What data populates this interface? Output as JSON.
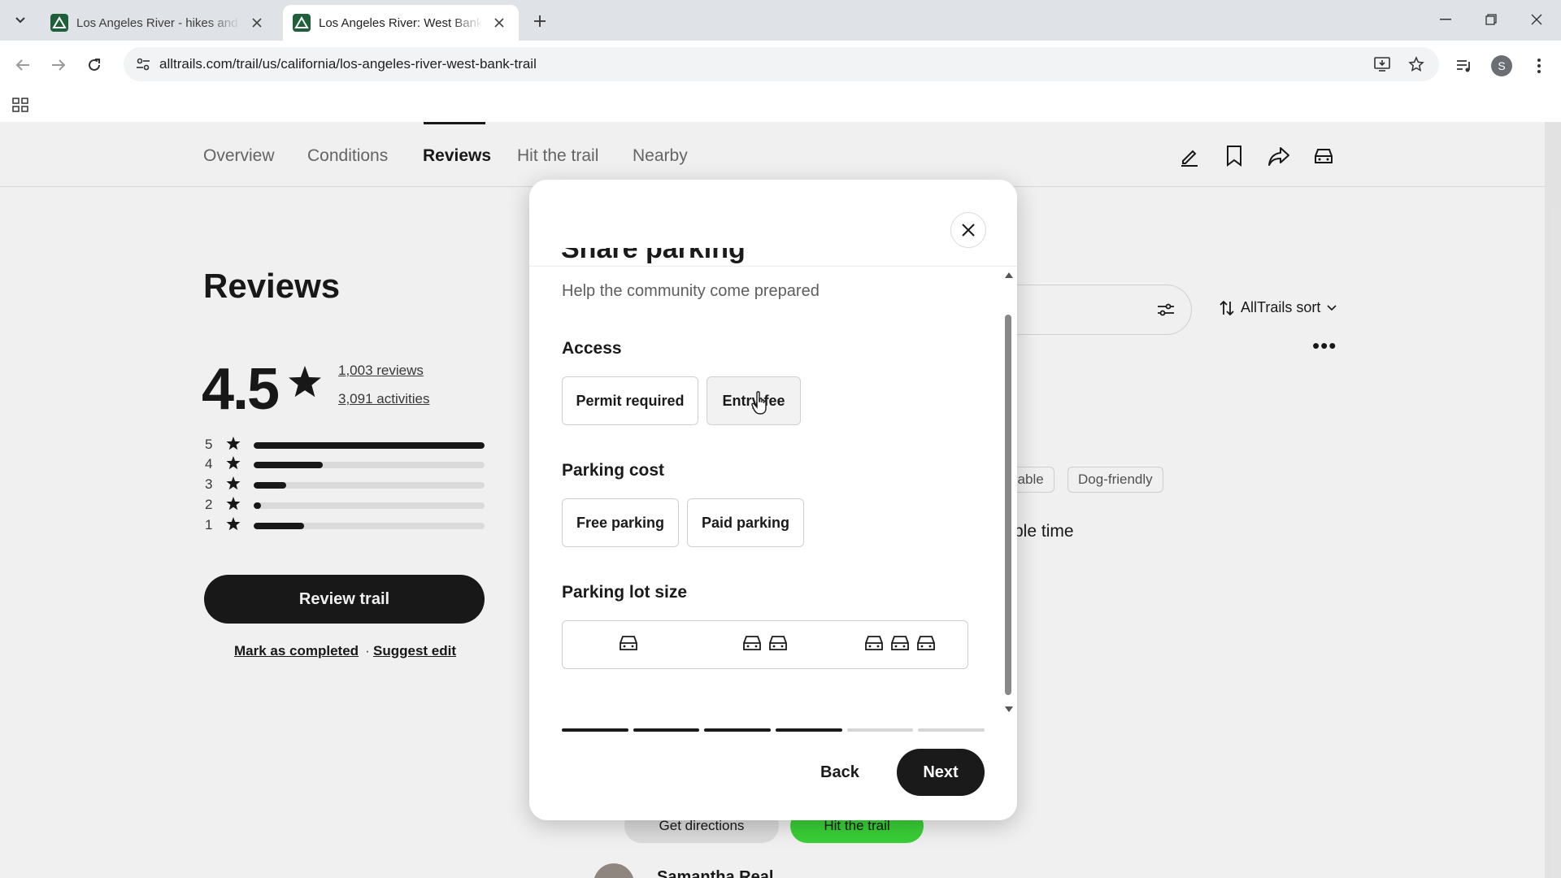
{
  "browser": {
    "tabs": [
      {
        "title": "Los Angeles River - hikes and trails",
        "active": false
      },
      {
        "title": "Los Angeles River: West Bank Trail",
        "active": true
      }
    ],
    "url": "alltrails.com/trail/us/california/los-angeles-river-west-bank-trail",
    "profile_initial": "S"
  },
  "section_nav": {
    "items": [
      "Overview",
      "Conditions",
      "Reviews",
      "Hit the trail",
      "Nearby"
    ],
    "active": "Reviews",
    "actions": [
      "edit-icon",
      "bookmark-icon",
      "share-icon",
      "car-icon"
    ]
  },
  "reviews": {
    "title": "Reviews",
    "rating": "4.5",
    "review_count": "1,003 reviews",
    "activity_count": "3,091 activities",
    "distribution": [
      {
        "stars": "5",
        "fraction": 1.0
      },
      {
        "stars": "4",
        "fraction": 0.3
      },
      {
        "stars": "3",
        "fraction": 0.14
      },
      {
        "stars": "2",
        "fraction": 0.03
      },
      {
        "stars": "1",
        "fraction": 0.22
      }
    ],
    "review_button": "Review trail",
    "mark_completed": "Mark as completed",
    "separator": "·",
    "suggest_edit": "Suggest edit"
  },
  "background": {
    "sort_label": "AllTrails sort",
    "chips": [
      "ilable",
      "Dog-friendly"
    ],
    "snippet": "ble time",
    "author": "Samantha Real",
    "directions_btn": "Get directions",
    "hit_trail_btn": "Hit the trail"
  },
  "modal": {
    "title_partial": "Share parking",
    "subtitle": "Help the community come prepared",
    "access": {
      "label": "Access",
      "options": [
        "Permit required",
        "Entry fee"
      ]
    },
    "parking_cost": {
      "label": "Parking cost",
      "options": [
        "Free parking",
        "Paid parking"
      ]
    },
    "lot_size": {
      "label": "Parking lot size",
      "options": [
        "small-lot-icon",
        "medium-lot-icon",
        "large-lot-icon"
      ]
    },
    "progress": {
      "total_steps": 6,
      "completed_steps": 4
    },
    "back_label": "Back",
    "next_label": "Next"
  },
  "colors": {
    "primary": "#1a1a1a",
    "brand_green": "#3ddc3b",
    "progress_done": "#1a1a1a",
    "progress_todo": "#d6d6d6"
  }
}
